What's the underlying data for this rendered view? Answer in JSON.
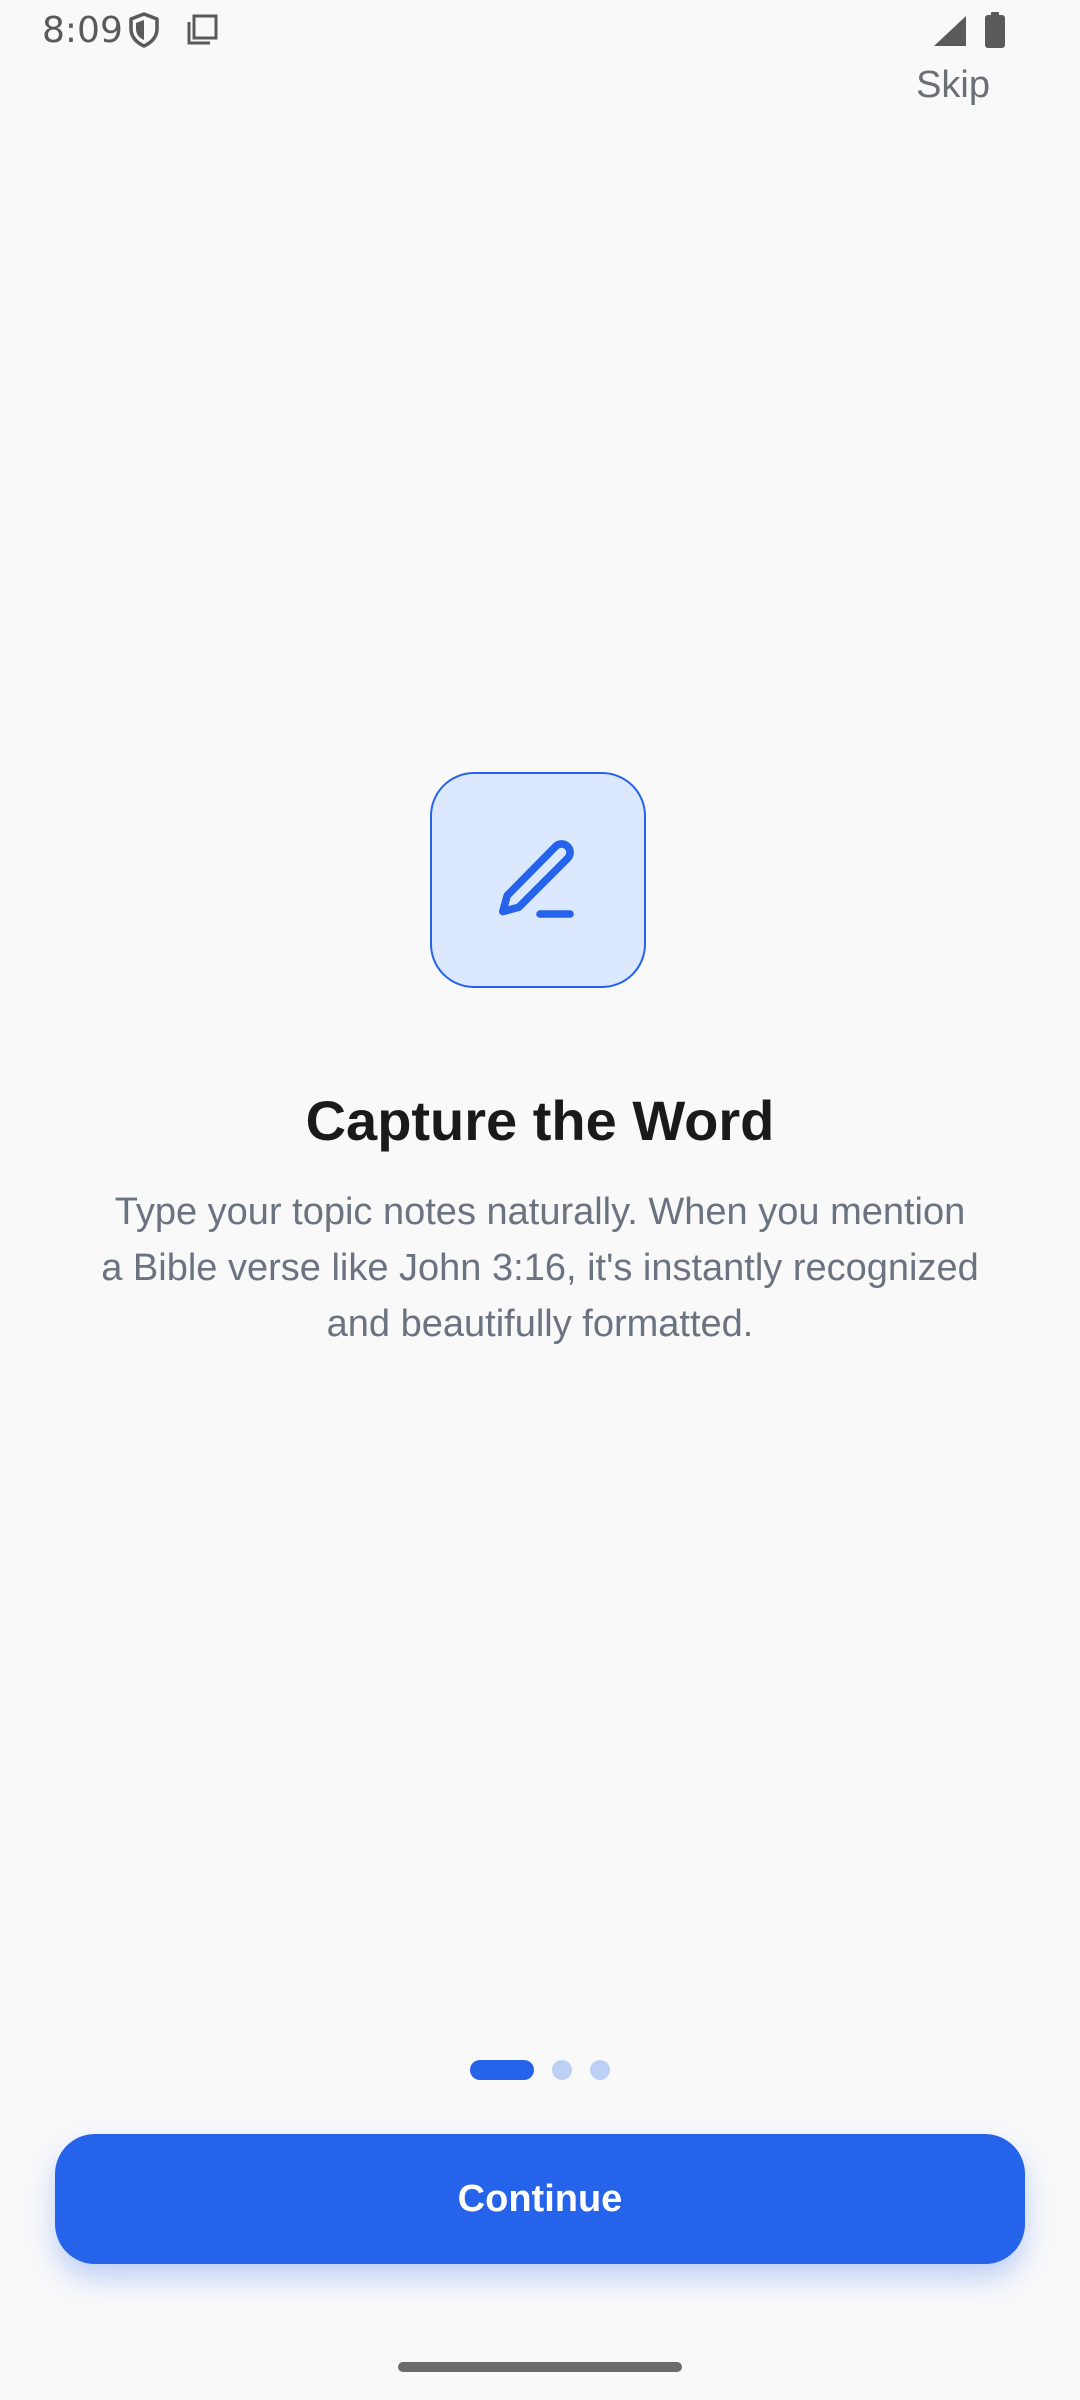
{
  "status_bar": {
    "time": "8:09",
    "icons": [
      "shield-icon",
      "screen-copy-icon",
      "signal-icon",
      "battery-icon"
    ]
  },
  "header": {
    "skip_label": "Skip"
  },
  "hero": {
    "icon": "pen-icon",
    "title": "Capture the Word",
    "description": "Type your topic notes naturally. When you mention a Bible verse like John 3:16, it's instantly recognized and beautifully formatted."
  },
  "pager": {
    "current_page": 1,
    "total_pages": 3
  },
  "footer": {
    "continue_label": "Continue"
  },
  "colors": {
    "accent": "#2563eb",
    "tile_background": "#dce8fd",
    "inactive_dot": "#bcd0f6",
    "background": "#f9f9fa",
    "body_text": "#6b7280"
  }
}
